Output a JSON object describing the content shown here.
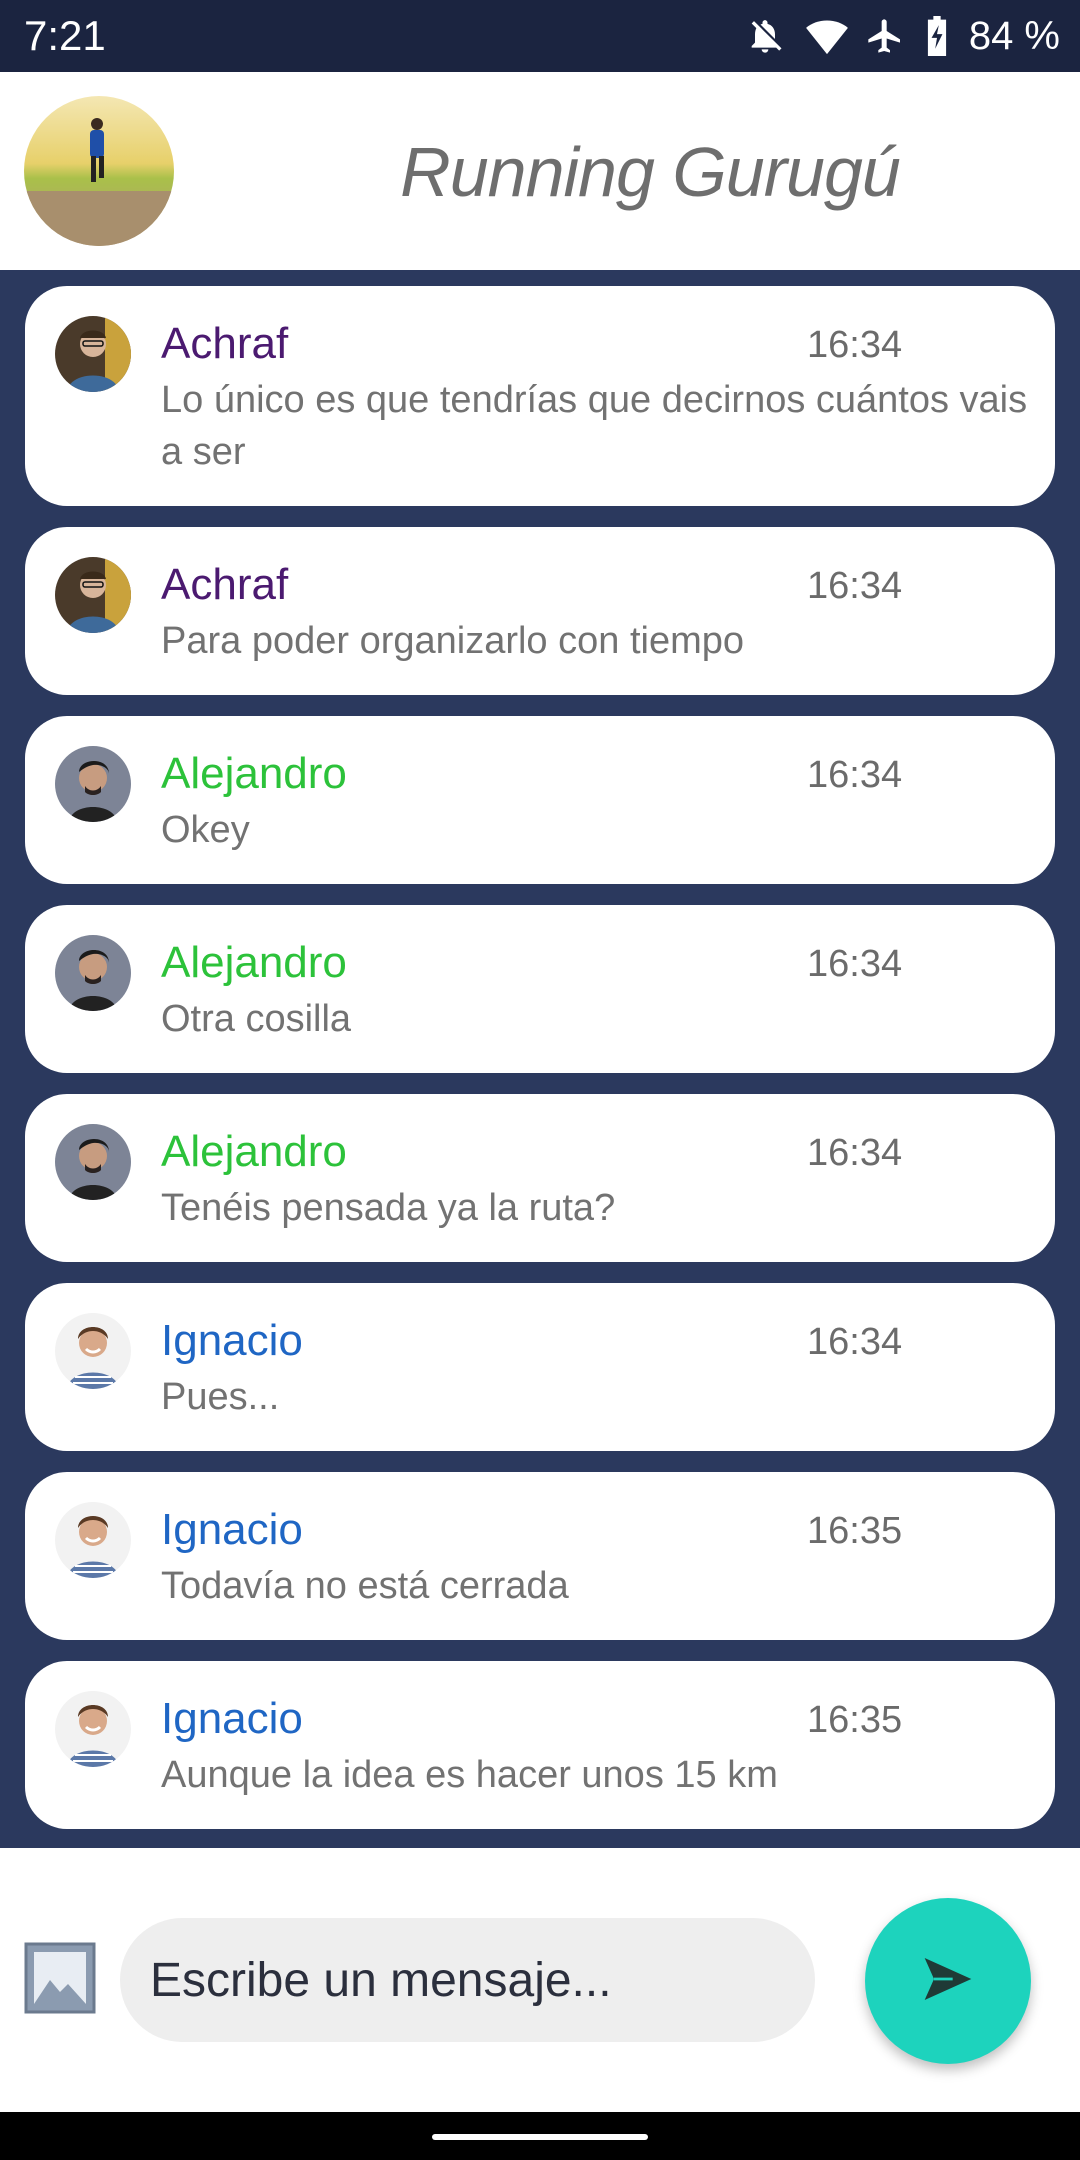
{
  "status_bar": {
    "time": "7:21",
    "battery": "84 %",
    "icons": [
      "notifications-off-icon",
      "wifi-icon",
      "airplane-mode-icon",
      "battery-charging-icon"
    ]
  },
  "header": {
    "title": "Running Gurugú"
  },
  "messages": [
    {
      "author": "Achraf",
      "time": "16:34",
      "text": "Lo único es que tendrías que decirnos cuántos vais a ser",
      "color": "#4b1a70"
    },
    {
      "author": "Achraf",
      "time": "16:34",
      "text": "Para poder organizarlo con tiempo",
      "color": "#4b1a70"
    },
    {
      "author": "Alejandro",
      "time": "16:34",
      "text": "Okey",
      "color": "#2cc23a"
    },
    {
      "author": "Alejandro",
      "time": "16:34",
      "text": "Otra cosilla",
      "color": "#2cc23a"
    },
    {
      "author": "Alejandro",
      "time": "16:34",
      "text": "Tenéis pensada ya la ruta?",
      "color": "#2cc23a"
    },
    {
      "author": "Ignacio",
      "time": "16:34",
      "text": "Pues...",
      "color": "#1f66c4"
    },
    {
      "author": "Ignacio",
      "time": "16:35",
      "text": "Todavía no está cerrada",
      "color": "#1f66c4"
    },
    {
      "author": "Ignacio",
      "time": "16:35",
      "text": "Aunque la idea es hacer unos 15 km",
      "color": "#1f66c4"
    }
  ],
  "composer": {
    "placeholder": "Escribe un mensaje...",
    "accent": "#1dd3bd"
  }
}
